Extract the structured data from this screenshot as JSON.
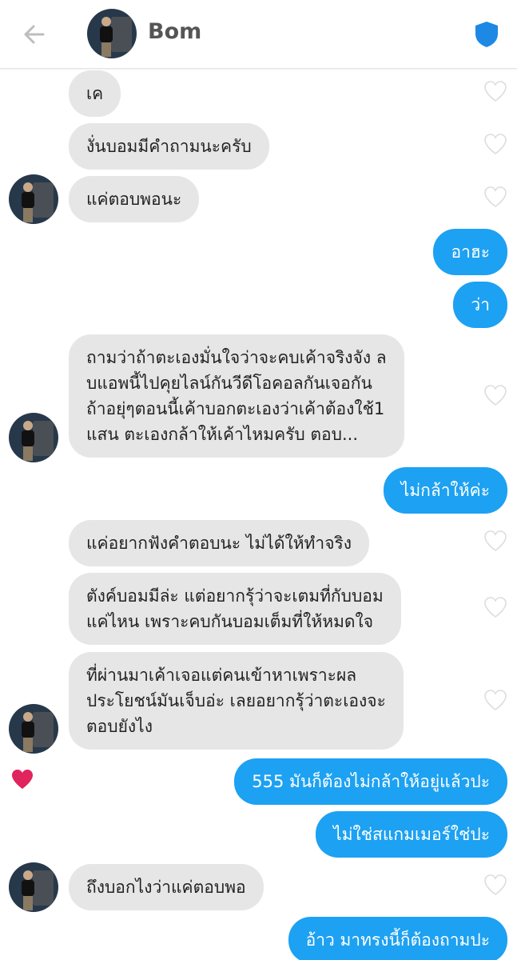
{
  "header": {
    "name": "Bom"
  },
  "messages": [
    {
      "text": "เค"
    },
    {
      "text": "งั่นบอมมีคำถามนะครับ"
    },
    {
      "text": "แค่ตอบพอนะ"
    },
    {
      "text": "อาฮะ"
    },
    {
      "text": "ว่า"
    },
    {
      "lines": [
        "ถามว่าถ้าตะเองมั่นใจว่าจะคบเค้าจริงจัง ล",
        "บแอพนี้ไปคุยไลน์กันวีดีโอคอลกันเจอกัน",
        "ถ้าอยุ่ๆตอนนี้เค้าบอกตะเองว่าเค้าต้องใช้1",
        "แสน ตะเองกล้าให้เค้าไหมครับ ตอบ..."
      ]
    },
    {
      "text": "ไม่กล้าให้ค่ะ"
    },
    {
      "text": "แค่อยากฟังคำตอบนะ ไม่ได้ให้ทำจริง"
    },
    {
      "lines": [
        "ตังค์บอมมีล่ะ  แต่อยากรุ้ว่าจะเตมที่กับบอม",
        "แค่ไหน เพราะคบกันบอมเต็มที่ให้หมดใจ"
      ]
    },
    {
      "lines": [
        "ที่ผ่านมาเค้าเจอแต่คนเข้าหาเพราะผล",
        "ประโยชน์มันเจ็บอ่ะ เลยอยากรุ้ว่าตะเองจะ",
        "ตอบยังไง"
      ]
    },
    {
      "text": "555 มันก็ต้องไม่กล้าให้อยู่แล้วปะ"
    },
    {
      "text": "ไม่ใช่สแกมเมอร์ใช่ปะ"
    },
    {
      "text": "ถึงบอกไงว่าแค่ตอบพอ"
    },
    {
      "text": "อ้าว มาทรงนี้ก็ต้องถามปะ"
    }
  ],
  "colors": {
    "incoming_bubble": "#e6e6e6",
    "outgoing_bubble": "#1da1f2",
    "shield_icon": "#1e88e5",
    "liked_heart": "#e0245e"
  }
}
